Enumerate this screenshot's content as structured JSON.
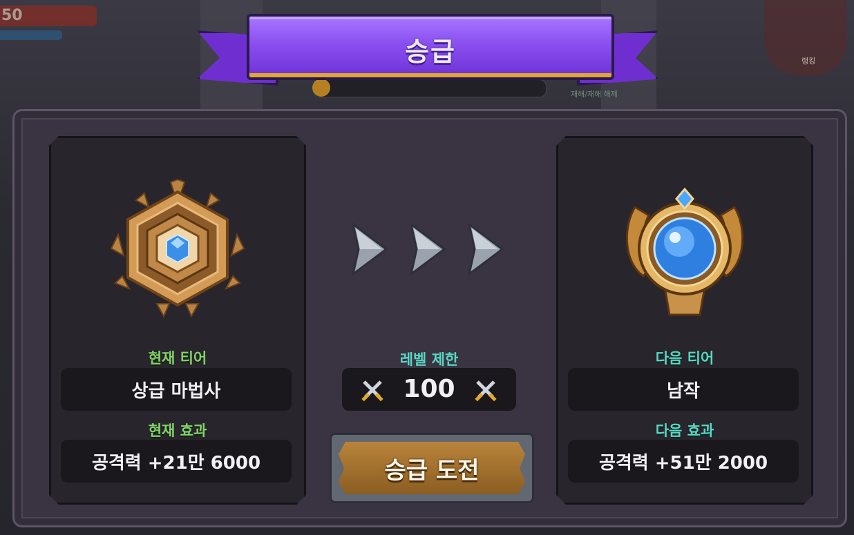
{
  "background": {
    "hp_value": "50",
    "rank_label": "랭킹",
    "note_text": "재해/재해 해제"
  },
  "title": "승급",
  "current": {
    "tier_label": "현재 티어",
    "tier_value": "상급 마법사",
    "effect_label": "현재 효과",
    "effect_value": "공격력 +21만 6000",
    "emblem_icon": "bronze-hexagon-laurel-emblem"
  },
  "level_limit": {
    "label": "레벨 제한",
    "value": "100",
    "icon": "crossed-swords-icon"
  },
  "next": {
    "tier_label": "다음 티어",
    "tier_value": "남작",
    "effect_label": "다음 효과",
    "effect_value": "공격력 +51만 2000",
    "emblem_icon": "gold-orb-crest-emblem"
  },
  "challenge_button": "승급 도전",
  "colors": {
    "ribbon": "#8a4ff0",
    "current_label": "#83d36a",
    "next_label": "#59d8c4",
    "button": "#a06f2c"
  }
}
